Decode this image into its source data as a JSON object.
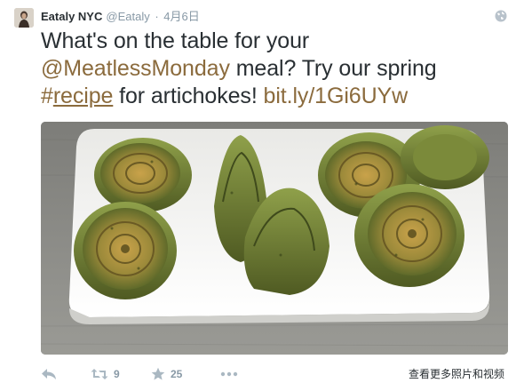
{
  "tweet": {
    "author_name": "Eataly NYC",
    "author_handle": "@Eataly",
    "separator": "·",
    "timestamp": "4月6日",
    "text": {
      "line1": "What's on the table for your",
      "mention": "@MeatlessMonday",
      "line2_rest": " meal? Try our spring",
      "hash_symbol": "#",
      "hash_word": "recipe",
      "line3_rest": " for artichokes! ",
      "link": "bit.ly/1Gi6UYw"
    },
    "media_alt": "artichokes-photo",
    "actions": {
      "reply_icon": "reply-icon",
      "retweet_icon": "retweet-icon",
      "retweet_count": "9",
      "favorite_icon": "star-icon",
      "favorite_count": "25",
      "more_icon": "more-dots-icon"
    },
    "more_media_label": "查看更多照片和视频"
  },
  "colors": {
    "link": "#8b6b3d",
    "meta": "#8899a6",
    "text": "#292f33"
  }
}
